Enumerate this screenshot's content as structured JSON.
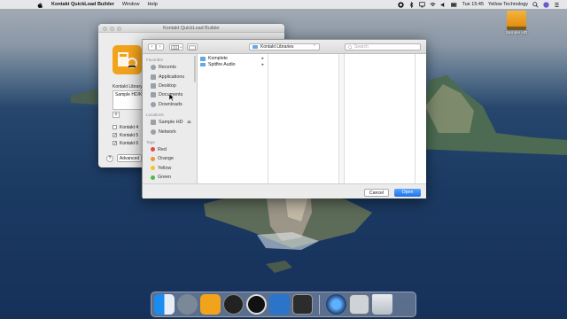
{
  "menubar": {
    "app_name": "Kontakt QuickLoad Builder",
    "items": [
      "Window",
      "Help"
    ],
    "clock": "Tue 15:45",
    "user": "Yellow Technology"
  },
  "desktop": {
    "drive_label": "Sample HD"
  },
  "app_window": {
    "title": "Kontakt QuickLoad Builder",
    "library_label": "Kontakt Library",
    "library_path": "Sample HD/K",
    "add_button": "+",
    "checkboxes": [
      {
        "label": "Kontakt 4",
        "checked": false
      },
      {
        "label": "Kontakt 5",
        "checked": true
      },
      {
        "label": "Kontakt 6",
        "checked": true
      }
    ],
    "help_button": "?",
    "advanced_button": "Advanced"
  },
  "dialog": {
    "path_popup": "Kontakt Libraries",
    "search_placeholder": "Search",
    "sidebar": {
      "favorites_header": "Favorites",
      "favorites": [
        "Recents",
        "Applications",
        "Desktop",
        "Documents",
        "Downloads"
      ],
      "locations_header": "Locations",
      "locations": [
        "Sample HD",
        "Network"
      ],
      "tags_header": "Tags",
      "tags": [
        {
          "label": "Red",
          "color": "#e5483f"
        },
        {
          "label": "Orange",
          "color": "#f0932b"
        },
        {
          "label": "Yellow",
          "color": "#f3c623"
        },
        {
          "label": "Green",
          "color": "#4cbb4c"
        }
      ]
    },
    "column1": [
      {
        "label": "Komplete",
        "has_children": true
      },
      {
        "label": "Spitfire Audio",
        "has_children": true
      }
    ],
    "cancel_button": "Cancel",
    "open_button": "Open"
  },
  "colors": {
    "accent_blue": "#1f72e8",
    "folder_blue": "#62a8e6",
    "app_orange": "#f2a31c"
  },
  "dock": {
    "apps": [
      "finder-icon",
      "launchpad-icon",
      "quickload-builder-icon",
      "clock-icon",
      "native-access-icon",
      "kontakt-icon",
      "app-icon",
      "quicktime-icon",
      "disk-utility-icon",
      "trash-icon"
    ]
  }
}
